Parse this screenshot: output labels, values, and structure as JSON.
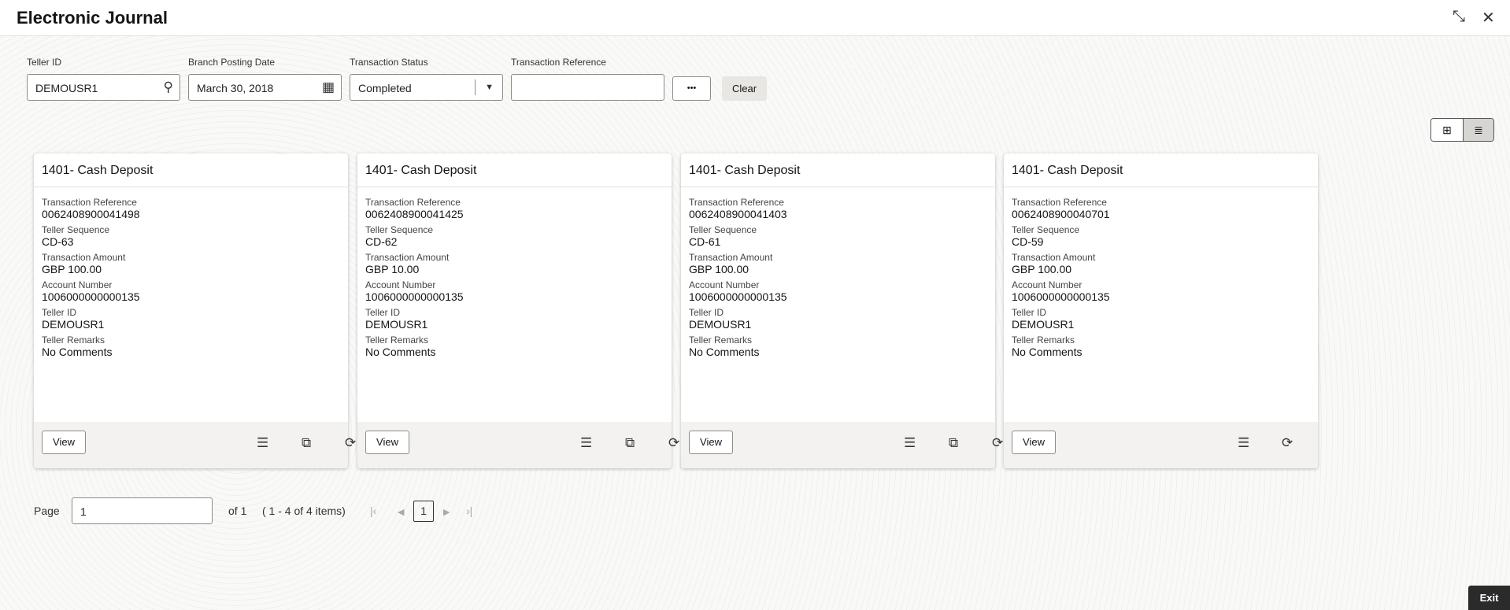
{
  "header": {
    "title": "Electronic Journal"
  },
  "filters": {
    "teller_id": {
      "label": "Teller ID",
      "value": "DEMOUSR1"
    },
    "branch_posting_date": {
      "label": "Branch Posting Date",
      "value": "March 30, 2018"
    },
    "transaction_status": {
      "label": "Transaction Status",
      "value": "Completed"
    },
    "transaction_reference": {
      "label": "Transaction Reference",
      "value": ""
    },
    "more_label": "•••",
    "clear_label": "Clear"
  },
  "labels": {
    "ref": "Transaction Reference",
    "seq": "Teller Sequence",
    "amt": "Transaction Amount",
    "acc": "Account Number",
    "tid": "Teller ID",
    "rem": "Teller Remarks",
    "view": "View"
  },
  "cards": [
    {
      "title": "1401- Cash Deposit",
      "ref": "0062408900041498",
      "seq": "CD-63",
      "amt": "GBP 100.00",
      "acc": "1006000000000135",
      "tid": "DEMOUSR1",
      "rem": "No Comments"
    },
    {
      "title": "1401- Cash Deposit",
      "ref": "0062408900041425",
      "seq": "CD-62",
      "amt": "GBP 10.00",
      "acc": "1006000000000135",
      "tid": "DEMOUSR1",
      "rem": "No Comments"
    },
    {
      "title": "1401- Cash Deposit",
      "ref": "0062408900041403",
      "seq": "CD-61",
      "amt": "GBP 100.00",
      "acc": "1006000000000135",
      "tid": "DEMOUSR1",
      "rem": "No Comments"
    },
    {
      "title": "1401- Cash Deposit",
      "ref": "0062408900040701",
      "seq": "CD-59",
      "amt": "GBP 100.00",
      "acc": "1006000000000135",
      "tid": "DEMOUSR1",
      "rem": "No Comments"
    }
  ],
  "pagination": {
    "page_label": "Page",
    "page_value": "1",
    "of": "of 1",
    "items": "( 1 - 4 of 4 items)",
    "current": "1"
  },
  "footer": {
    "exit_label": "Exit"
  }
}
